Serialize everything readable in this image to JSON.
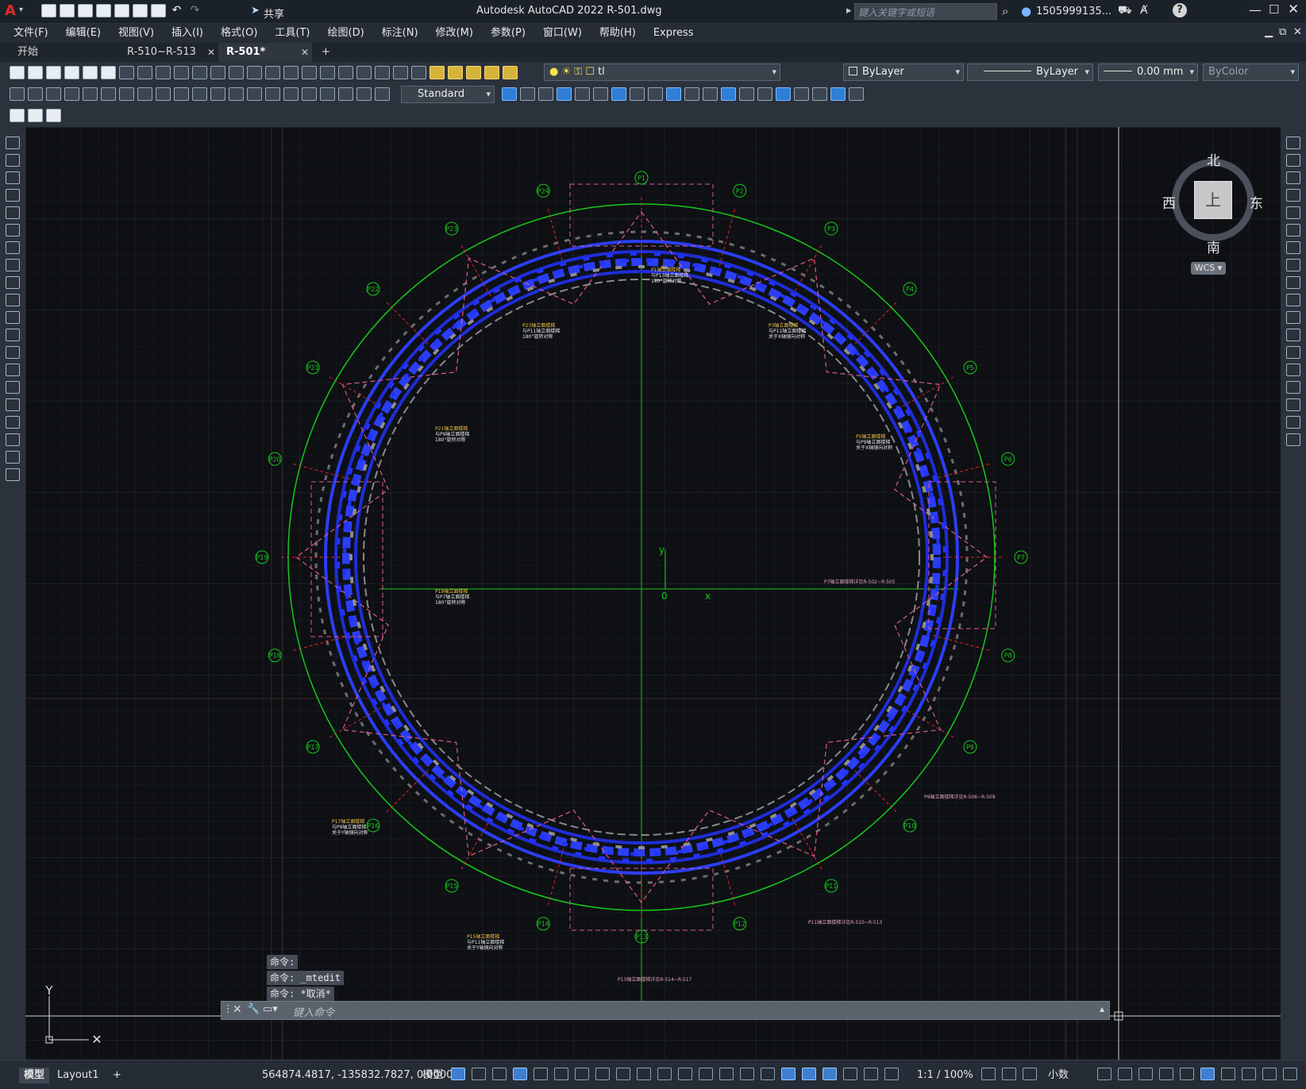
{
  "app": {
    "title": "Autodesk AutoCAD 2022   R-501.dwg",
    "logo": "A",
    "share": "共享",
    "search_placeholder": "键入关键字或短语",
    "user": "1505999135...",
    "help": "?"
  },
  "menu": [
    "文件(F)",
    "编辑(E)",
    "视图(V)",
    "插入(I)",
    "格式(O)",
    "工具(T)",
    "绘图(D)",
    "标注(N)",
    "修改(M)",
    "参数(P)",
    "窗口(W)",
    "帮助(H)",
    "Express"
  ],
  "tabs": {
    "start": "开始",
    "t1": "R-510~R-513",
    "t2": "R-501*",
    "add": "+"
  },
  "props": {
    "layer": "tl",
    "color": "ByLayer",
    "linetype": "ByLayer",
    "lineweight": "0.00 mm",
    "plotstyle": "ByColor",
    "textstyle": "Standard"
  },
  "viewcube": {
    "n": "北",
    "s": "南",
    "e": "东",
    "w": "西",
    "top": "上",
    "wcs": "WCS"
  },
  "grid_labels": [
    "P1",
    "P2",
    "P3",
    "P4",
    "P5",
    "P6",
    "P7",
    "P8",
    "P9",
    "P10",
    "P11",
    "P12",
    "P13",
    "P14",
    "P15",
    "P16",
    "P17",
    "P18",
    "P19",
    "P20",
    "P21",
    "P22",
    "P23",
    "P24"
  ],
  "ucs": {
    "y": "Y",
    "x": "X",
    "cy": "y",
    "cx": "x",
    "o": "0"
  },
  "notes": [
    {
      "t": "P1轴立面楼梯",
      "s": "与P13轴立面楼梯",
      "r": "180°旋转对称"
    },
    {
      "t": "P3轴立面楼梯",
      "s": "与P11轴立面楼梯",
      "r": "关于X轴镜向对称"
    },
    {
      "t": "P23轴立面楼梯",
      "s": "与P11轴立面楼梯",
      "r": "180°旋转对称"
    },
    {
      "t": "P21轴立面楼梯",
      "s": "与P9轴立面楼梯",
      "r": "180°旋转对称"
    },
    {
      "t": "P5轴立面楼梯",
      "s": "与P9轴立面楼梯",
      "r": "关于X轴镜向对称"
    },
    {
      "t": "P19轴立面楼梯",
      "s": "与P7轴立面楼梯",
      "r": "180°旋转对称"
    },
    {
      "t": "P17轴立面楼梯",
      "s": "与P9轴立面楼梯",
      "r": "关于Y轴镜向对称"
    },
    {
      "t": "P15轴立面楼梯",
      "s": "与P11轴立面楼梯",
      "r": "关于Y轴镜向对称"
    }
  ],
  "refs": [
    "P7轴立面楼梯详见R-502~R-505",
    "P9轴立面楼梯详见R-506~R-509",
    "P11轴立面楼梯详见R-510~R-513",
    "P13轴立面楼梯详见R-514~R-517"
  ],
  "command": {
    "h1": "命令:",
    "h2": "命令: _mtedit",
    "h3": "命令: *取消*",
    "placeholder": "键入命令"
  },
  "status": {
    "coords": "564874.4817, -135832.7827, 0.0000",
    "model": "模型",
    "scale": "1:1 / 100%",
    "units": "小数"
  },
  "layout_tabs": {
    "model": "模型",
    "layout1": "Layout1",
    "add": "+"
  },
  "colors": {
    "accent": "#2f7fd6",
    "ring": "#17c81a",
    "blue": "#1f2dd8",
    "pink": "#e05a8a"
  }
}
